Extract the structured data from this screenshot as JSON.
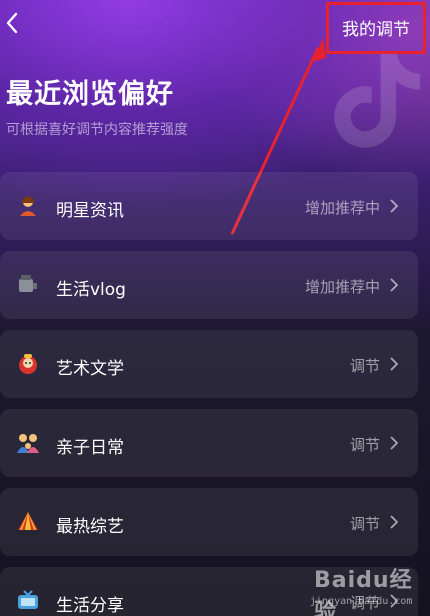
{
  "header": {
    "back_icon": "chevron-left-icon",
    "my_adjust_label": "我的调节"
  },
  "page": {
    "title": "最近浏览偏好",
    "subtitle": "可根据喜好调节内容推荐强度"
  },
  "items": [
    {
      "icon": "person-emoji-icon",
      "label": "明星资讯",
      "status": "增加推荐中"
    },
    {
      "icon": "vlog-emoji-icon",
      "label": "生活vlog",
      "status": "增加推荐中"
    },
    {
      "icon": "art-emoji-icon",
      "label": "艺术文学",
      "status": "调节"
    },
    {
      "icon": "family-emoji-icon",
      "label": "亲子日常",
      "status": "调节"
    },
    {
      "icon": "circus-tent-emoji-icon",
      "label": "最热综艺",
      "status": "调节"
    },
    {
      "icon": "tv-emoji-icon",
      "label": "生活分享",
      "status": "调节"
    }
  ],
  "watermark": {
    "brand": "Baidu经验",
    "url": "jingyan.baidu.com"
  },
  "colors": {
    "annotation_red": "#e8212f",
    "card_bg": "rgba(255,255,255,0.075)",
    "accent_purple": "#7a35d0"
  }
}
